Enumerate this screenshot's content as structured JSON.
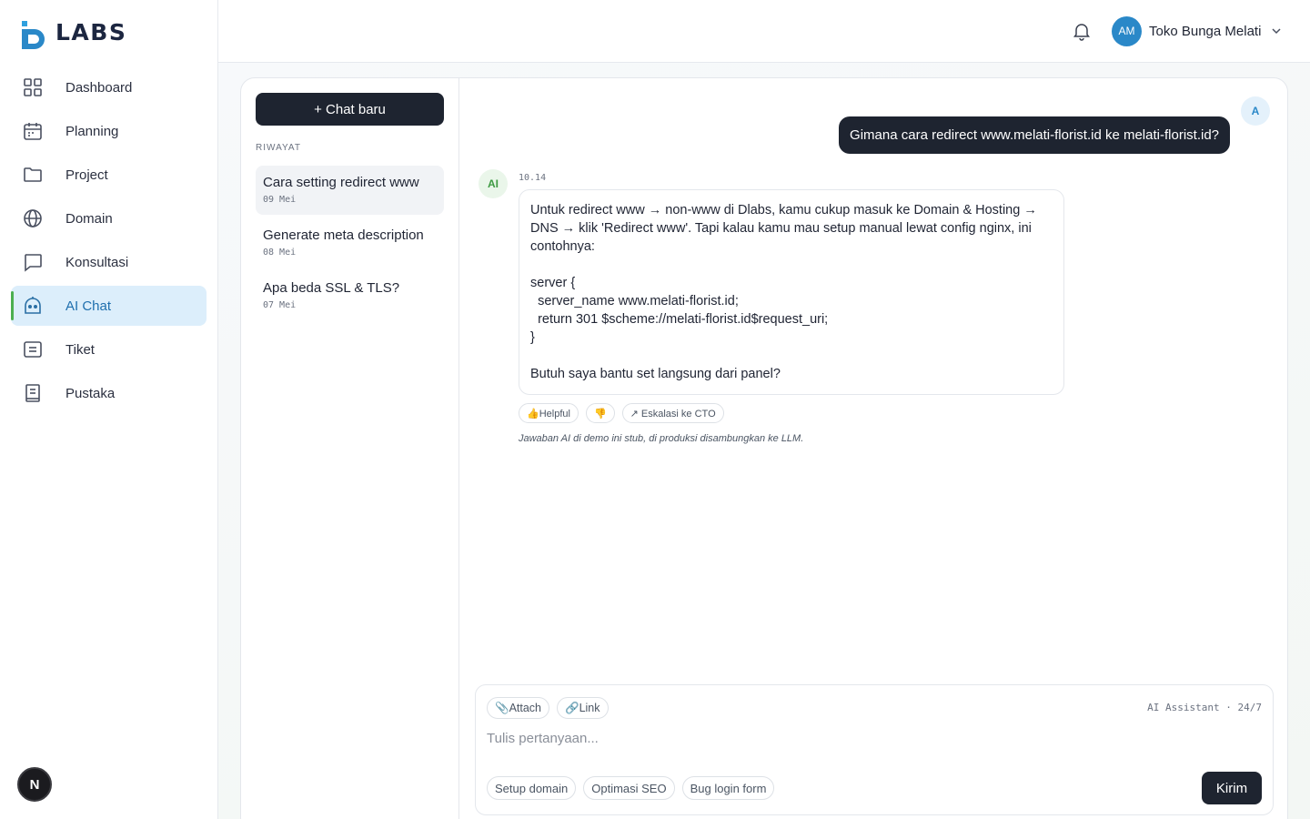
{
  "brand": {
    "logo_text": "LABS",
    "logo_mark": "D"
  },
  "sidebar": {
    "items": [
      {
        "label": "Dashboard",
        "icon": "grid-icon",
        "active": false
      },
      {
        "label": "Planning",
        "icon": "calendar-icon",
        "active": false
      },
      {
        "label": "Project",
        "icon": "folder-icon",
        "active": false
      },
      {
        "label": "Domain",
        "icon": "globe-icon",
        "active": false
      },
      {
        "label": "Konsultasi",
        "icon": "chat-bubble-icon",
        "active": false
      },
      {
        "label": "AI Chat",
        "icon": "robot-icon",
        "active": true
      },
      {
        "label": "Tiket",
        "icon": "ticket-icon",
        "active": false
      },
      {
        "label": "Pustaka",
        "icon": "book-icon",
        "active": false
      }
    ],
    "bottom_badge": "N"
  },
  "header": {
    "user": {
      "initials": "AM",
      "name": "Toko Bunga Melati"
    }
  },
  "history": {
    "new_chat_label": "+ Chat baru",
    "heading": "RIWAYAT",
    "items": [
      {
        "title": "Cara setting redirect www",
        "date": "09 Mei",
        "active": true
      },
      {
        "title": "Generate meta description",
        "date": "08 Mei",
        "active": false
      },
      {
        "title": "Apa beda SSL & TLS?",
        "date": "07 Mei",
        "active": false
      }
    ]
  },
  "chat": {
    "user_avatar": "A",
    "user_message": "Gimana cara redirect www.melati-florist.id ke melati-florist.id?",
    "ai_avatar": "AI",
    "ai_time": "10.14",
    "ai_message": "Untuk redirect www → non-www di Dlabs, kamu cukup masuk ke Domain & Hosting → DNS → klik 'Redirect www'. Tapi kalau kamu mau setup manual lewat config nginx, ini contohnya:\n\nserver {\n  server_name www.melati-florist.id;\n  return 301 $scheme://melati-florist.id$request_uri;\n}\n\nButuh saya bantu set langsung dari panel?",
    "reactions": {
      "helpful": "👍Helpful",
      "unhelpful": "👎",
      "escalate": "↗ Eskalasi ke CTO"
    },
    "note": "Jawaban AI di demo ini stub, di produksi disambungkan ke LLM."
  },
  "composer": {
    "attach_label": "📎Attach",
    "link_label": "🔗Link",
    "assistant_label": "AI Assistant · 24/7",
    "placeholder": "Tulis pertanyaan...",
    "suggestions": [
      "Setup domain",
      "Optimasi SEO",
      "Bug login form"
    ],
    "send_label": "Kirim"
  },
  "colors": {
    "primary_dark": "#1e2430",
    "accent_blue": "#2a88c8",
    "active_bg": "#dceefb",
    "active_bar": "#4caf50"
  }
}
